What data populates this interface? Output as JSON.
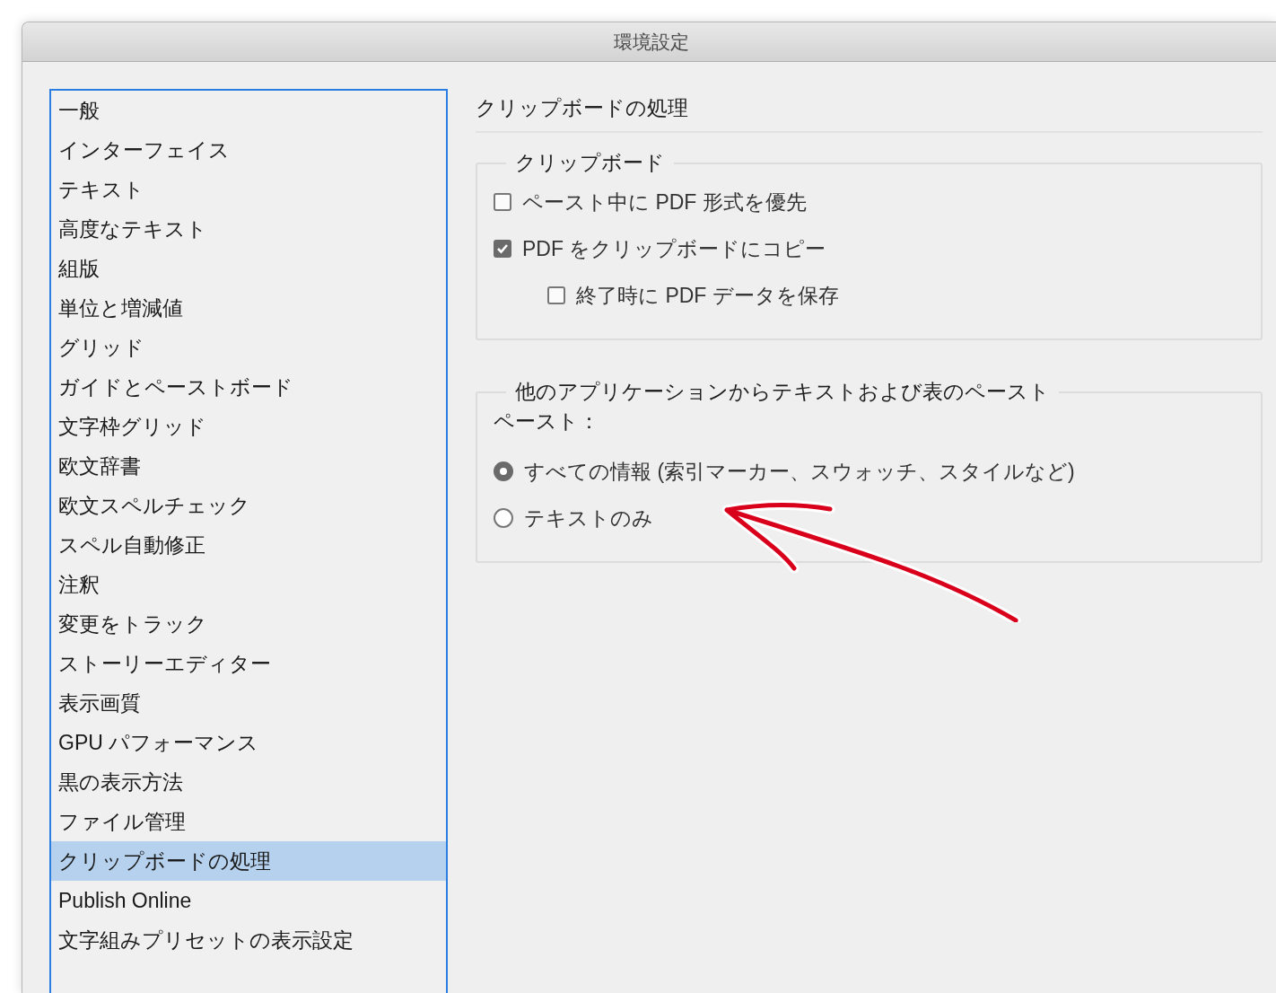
{
  "window": {
    "title": "環境設定"
  },
  "sidebar": {
    "items": [
      {
        "label": "一般",
        "selected": false
      },
      {
        "label": "インターフェイス",
        "selected": false
      },
      {
        "label": "テキスト",
        "selected": false
      },
      {
        "label": "高度なテキスト",
        "selected": false
      },
      {
        "label": "組版",
        "selected": false
      },
      {
        "label": "単位と増減値",
        "selected": false
      },
      {
        "label": "グリッド",
        "selected": false
      },
      {
        "label": "ガイドとペーストボード",
        "selected": false
      },
      {
        "label": "文字枠グリッド",
        "selected": false
      },
      {
        "label": "欧文辞書",
        "selected": false
      },
      {
        "label": "欧文スペルチェック",
        "selected": false
      },
      {
        "label": "スペル自動修正",
        "selected": false
      },
      {
        "label": "注釈",
        "selected": false
      },
      {
        "label": "変更をトラック",
        "selected": false
      },
      {
        "label": "ストーリーエディター",
        "selected": false
      },
      {
        "label": "表示画質",
        "selected": false
      },
      {
        "label": "GPU パフォーマンス",
        "selected": false
      },
      {
        "label": "黒の表示方法",
        "selected": false
      },
      {
        "label": "ファイル管理",
        "selected": false
      },
      {
        "label": "クリップボードの処理",
        "selected": true
      },
      {
        "label": "Publish Online",
        "selected": false
      },
      {
        "label": "文字組みプリセットの表示設定",
        "selected": false
      }
    ]
  },
  "panel": {
    "title": "クリップボードの処理",
    "groups": [
      {
        "title": "クリップボード",
        "options": [
          {
            "kind": "checkbox",
            "label": "ペースト中に PDF 形式を優先",
            "checked": false
          },
          {
            "kind": "checkbox",
            "label": "PDF をクリップボードにコピー",
            "checked": true,
            "children": [
              {
                "kind": "checkbox",
                "label": "終了時に PDF データを保存",
                "checked": false
              }
            ]
          }
        ]
      },
      {
        "title": "他のアプリケーションからテキストおよび表のペースト",
        "label": "ペースト：",
        "options": [
          {
            "kind": "radio",
            "label": "すべての情報 (索引マーカー、スウォッチ、スタイルなど)",
            "selected": true
          },
          {
            "kind": "radio",
            "label": "テキストのみ",
            "selected": false
          }
        ]
      }
    ]
  }
}
